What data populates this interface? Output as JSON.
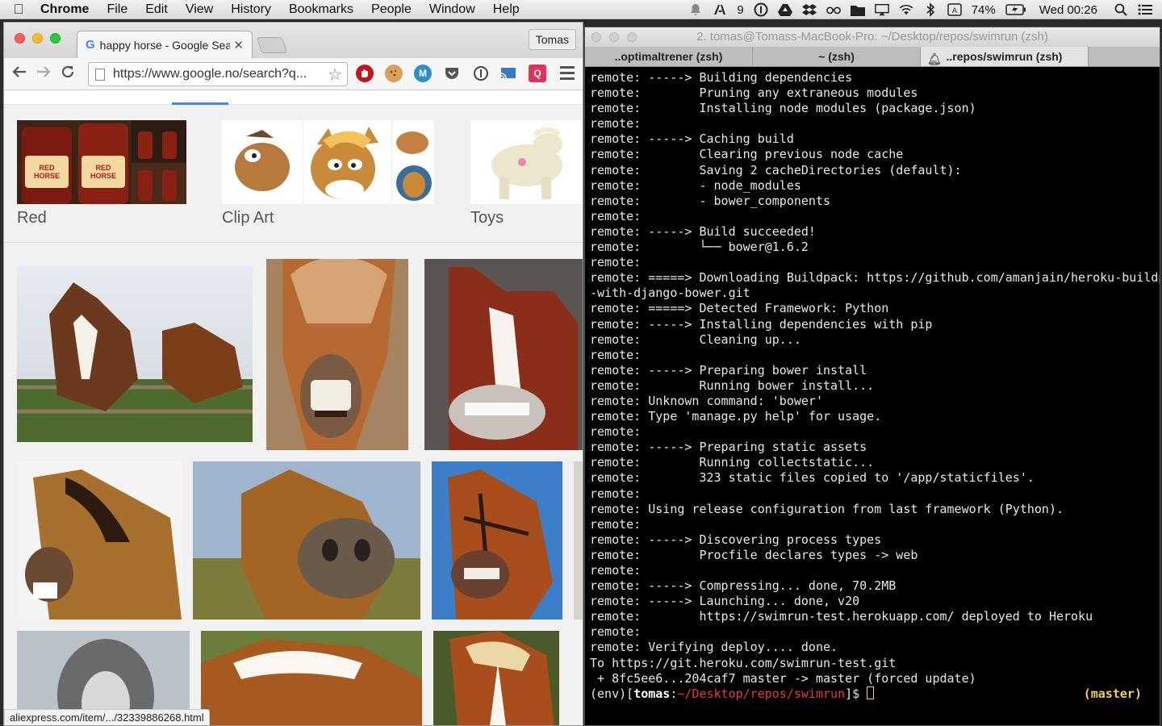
{
  "menubar": {
    "app_name": "Chrome",
    "items": [
      "File",
      "Edit",
      "View",
      "History",
      "Bookmarks",
      "People",
      "Window",
      "Help"
    ],
    "status": {
      "adobe_count": "9",
      "battery": "74%",
      "clock": "Wed 00:26"
    },
    "status_icons": [
      "bell-icon",
      "adobe-icon",
      "onepassword-icon",
      "drive-icon",
      "dropbox-icon",
      "glasses-icon",
      "folder-icon",
      "airplay-icon",
      "wifi-icon",
      "bluetooth-icon",
      "keyboard-icon",
      "battery-icon",
      "spotlight-icon",
      "list-icon"
    ]
  },
  "chrome": {
    "tab_title": "happy horse - Google Sear",
    "profile_name": "Tomas",
    "url": "https://www.google.no/search?q...",
    "categories": [
      {
        "label": "Red"
      },
      {
        "label": "Clip Art"
      },
      {
        "label": "Toys"
      }
    ],
    "status_url": "aliexpress.com/item/.../32339886268.html"
  },
  "terminal": {
    "window_title": "2. tomas@Tomass-MacBook-Pro: ~/Desktop/repos/swimrun (zsh)",
    "tabs": [
      "..optimaltrener (zsh)",
      "~ (zsh)",
      "..repos/swimrun (zsh)"
    ],
    "lines": [
      "remote: -----> Building dependencies",
      "remote:        Pruning any extraneous modules",
      "remote:        Installing node modules (package.json)",
      "remote:",
      "remote: -----> Caching build",
      "remote:        Clearing previous node cache",
      "remote:        Saving 2 cacheDirectories (default):",
      "remote:        - node_modules",
      "remote:        - bower_components",
      "remote:",
      "remote: -----> Build succeeded!",
      "remote:        └── bower@1.6.2",
      "remote:",
      "remote: =====> Downloading Buildpack: https://github.com/amanjain/heroku-buildpack-python",
      "-with-django-bower.git",
      "remote: =====> Detected Framework: Python",
      "remote: -----> Installing dependencies with pip",
      "remote:        Cleaning up...",
      "remote:",
      "remote: -----> Preparing bower install",
      "remote:        Running bower install...",
      "remote: Unknown command: 'bower'",
      "remote: Type 'manage.py help' for usage.",
      "remote:",
      "remote: -----> Preparing static assets",
      "remote:        Running collectstatic...",
      "remote:        323 static files copied to '/app/staticfiles'.",
      "remote:",
      "remote: Using release configuration from last framework (Python).",
      "remote:",
      "remote: -----> Discovering process types",
      "remote:        Procfile declares types -> web",
      "remote:",
      "remote: -----> Compressing... done, 70.2MB",
      "remote: -----> Launching... done, v20",
      "remote:        https://swimrun-test.herokuapp.com/ deployed to Heroku",
      "remote:",
      "remote: Verifying deploy.... done.",
      "To https://git.heroku.com/swimrun-test.git",
      " + 8fc5ee6...204caf7 master -> master (forced update)"
    ],
    "prompt": {
      "env": "(env)[",
      "user": "tomas",
      "sep": ":",
      "path": "~/Desktop/repos/swimrun",
      "suffix": "]$ ",
      "branch": "(master)"
    }
  }
}
